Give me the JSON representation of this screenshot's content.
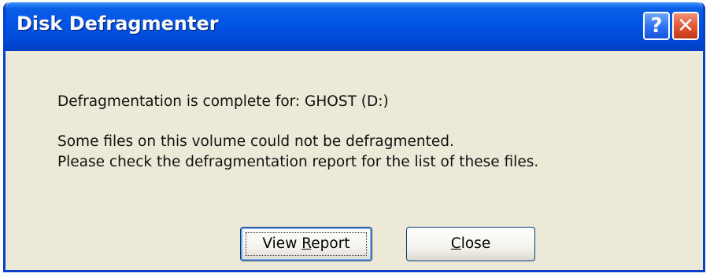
{
  "window": {
    "title": "Disk Defragmenter",
    "help_glyph": "?",
    "close_glyph": "✕"
  },
  "message": {
    "line1": "Defragmentation is complete for: GHOST (D:)",
    "line2": "Some files on this volume could not be defragmented.",
    "line3": "Please check the defragmentation report for the list of these files."
  },
  "buttons": {
    "view_report": {
      "pre": "View ",
      "mnemonic": "R",
      "post": "eport"
    },
    "close": {
      "pre": "",
      "mnemonic": "C",
      "post": "lose"
    }
  },
  "icons": [
    "help-icon",
    "close-icon"
  ],
  "colors": {
    "titlebar": "#0055e5",
    "dialog_bg": "#ece9d8",
    "close_red": "#e0532f"
  }
}
